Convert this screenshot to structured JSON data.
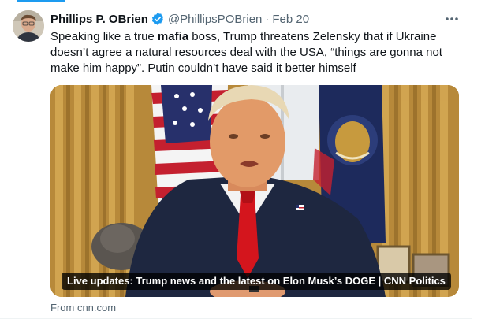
{
  "tweet": {
    "author": {
      "display_name": "Phillips P. OBrien",
      "handle": "@PhillipsPOBrien",
      "verified": true,
      "avatar": "author-avatar"
    },
    "date": "Feb 20",
    "separator": "·",
    "more_icon": "more-horizontal-icon",
    "text_parts": {
      "before": "Speaking like a true ",
      "bold": "mafia",
      "after": " boss, Trump threatens Zelensky that if Ukraine doesn’t agree a natural resources deal with the USA, “things are gonna not make him happy”.  Putin couldn’t have said it better himself"
    }
  },
  "card": {
    "title": "Live updates: Trump news and the latest on Elon Musk’s DOGE | CNN Politics",
    "source": "From cnn.com",
    "image": "oval-office-photo"
  },
  "colors": {
    "accent": "#1d9bf0",
    "text": "#0f1419",
    "muted": "#536471",
    "caption_bg": "#000000"
  }
}
